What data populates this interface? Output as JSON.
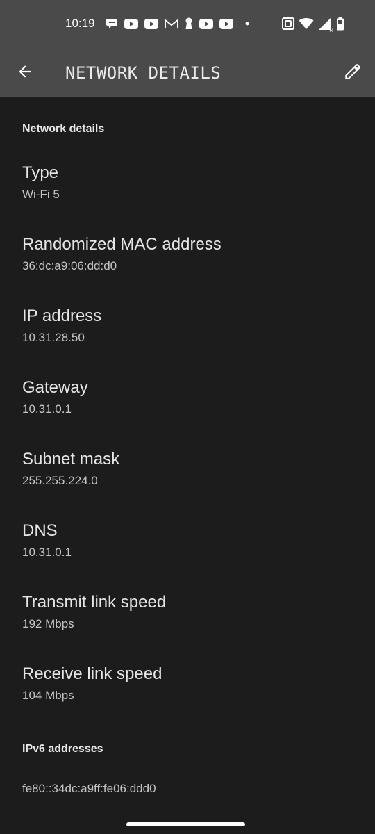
{
  "status_bar": {
    "time": "10:19",
    "notification_icons": [
      "chat-bubble-icon",
      "youtube-icon",
      "youtube-icon",
      "gmail-icon",
      "keyhole-icon",
      "youtube-icon",
      "youtube-icon",
      "dot-icon"
    ],
    "system_icons": [
      "nfc-icon",
      "wifi-icon",
      "signal-icon",
      "battery-icon"
    ],
    "signal_badge": "R"
  },
  "app_bar": {
    "title": "NETWORK DETAILS",
    "back_icon": "arrow-back-icon",
    "edit_icon": "pencil-icon"
  },
  "network_details": {
    "header": "Network details",
    "items": [
      {
        "title": "Type",
        "value": "Wi-Fi 5"
      },
      {
        "title": "Randomized MAC address",
        "value": "36:dc:a9:06:dd:d0"
      },
      {
        "title": "IP address",
        "value": "10.31.28.50"
      },
      {
        "title": "Gateway",
        "value": "10.31.0.1"
      },
      {
        "title": "Subnet mask",
        "value": "255.255.224.0"
      },
      {
        "title": "DNS",
        "value": "10.31.0.1"
      },
      {
        "title": "Transmit link speed",
        "value": "192 Mbps"
      },
      {
        "title": "Receive link speed",
        "value": "104 Mbps"
      }
    ]
  },
  "ipv6": {
    "header": "IPv6 addresses",
    "addresses": [
      "fe80::34dc:a9ff:fe06:ddd0"
    ]
  },
  "colors": {
    "background": "#1c1c1c",
    "app_bar": "#4a4a4a",
    "text_primary": "#e6e6e6",
    "text_secondary": "#c6c6c6"
  }
}
